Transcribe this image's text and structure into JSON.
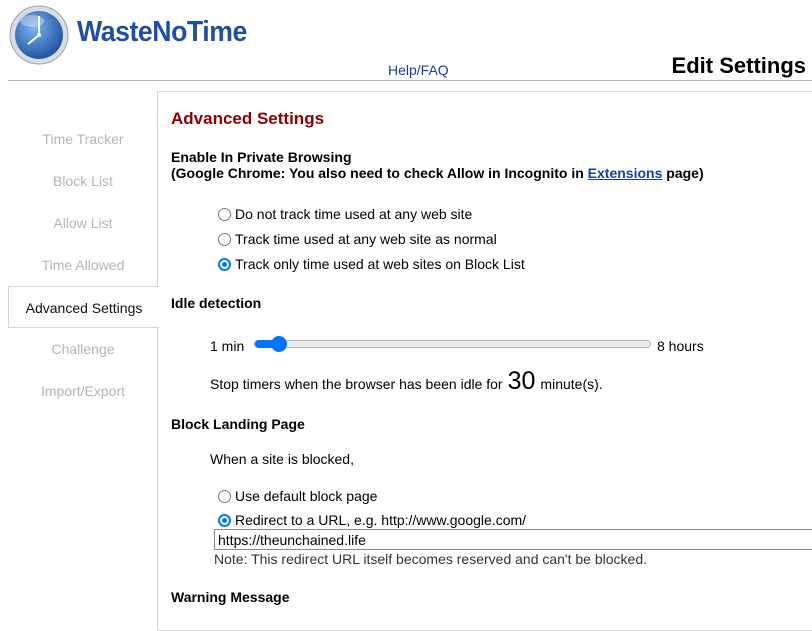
{
  "header": {
    "brand": "WasteNoTime",
    "help_link": "Help/FAQ",
    "page_title": "Edit Settings"
  },
  "sidebar": {
    "items": [
      {
        "label": "Time Tracker",
        "active": false
      },
      {
        "label": "Block List",
        "active": false
      },
      {
        "label": "Allow List",
        "active": false
      },
      {
        "label": "Time Allowed",
        "active": false
      },
      {
        "label": "Advanced Settings",
        "active": true
      },
      {
        "label": "Challenge",
        "active": false
      },
      {
        "label": "Import/Export",
        "active": false
      }
    ]
  },
  "main": {
    "section_title": "Advanced Settings",
    "private_browsing": {
      "heading": "Enable In Private Browsing",
      "note_prefix": "(Google Chrome: You also need to check Allow in Incognito in ",
      "note_link": "Extensions",
      "note_suffix": " page)",
      "options": [
        {
          "label": "Do not track time used at any web site",
          "checked": false
        },
        {
          "label": "Track time used at any web site as normal",
          "checked": false
        },
        {
          "label": "Track only time used at web sites on Block List",
          "checked": true
        }
      ]
    },
    "idle": {
      "heading": "Idle detection",
      "min_label": "1 min",
      "max_label": "8 hours",
      "slider_fraction": 0.06,
      "text_before": "Stop timers when the browser has been idle for",
      "value": "30",
      "text_after": "minute(s)."
    },
    "block_landing": {
      "heading": "Block Landing Page",
      "intro": "When a site is blocked,",
      "options": [
        {
          "label": "Use default block page",
          "checked": false
        },
        {
          "label": "Redirect to a URL, e.g. http://www.google.com/",
          "checked": true
        }
      ],
      "url_value": "https://theunchained.life",
      "note": "Note: This redirect URL itself becomes reserved and can't be blocked."
    },
    "warning_heading": "Warning Message"
  },
  "colors": {
    "brand": "#1f4fa5",
    "section_title": "#8b0000",
    "accent": "#0075ff",
    "inactive_nav": "#b4b4b4"
  }
}
